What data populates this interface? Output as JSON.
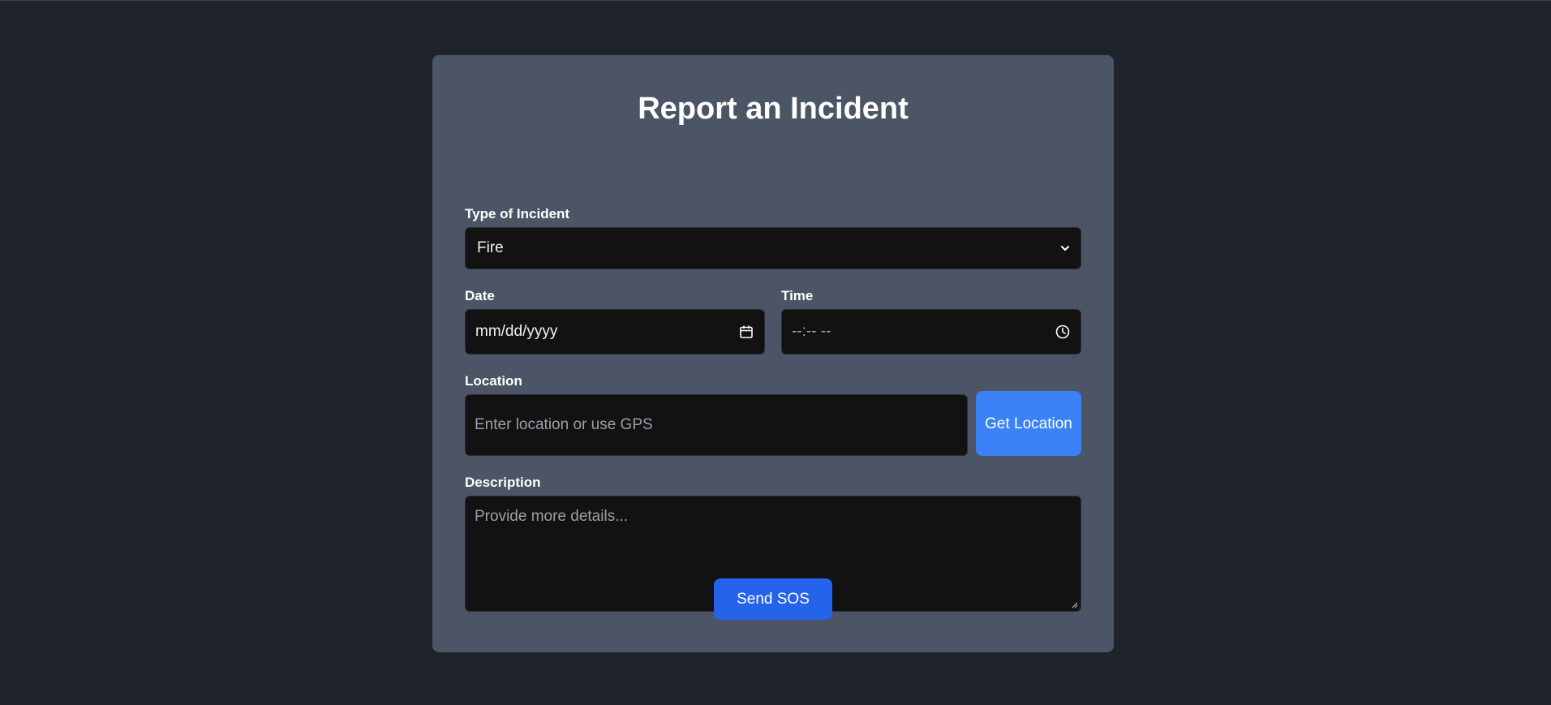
{
  "form": {
    "title": "Report an Incident",
    "incident_type": {
      "label": "Type of Incident",
      "selected_value": "Fire"
    },
    "date": {
      "label": "Date",
      "placeholder": "mm/dd/yyyy"
    },
    "time": {
      "label": "Time",
      "placeholder": "--:-- --"
    },
    "location": {
      "label": "Location",
      "placeholder": "Enter location or use GPS",
      "button_label": "Get Location"
    },
    "description": {
      "label": "Description",
      "placeholder": "Provide more details..."
    },
    "submit_label": "Send SOS"
  },
  "icons": {
    "dropdown": "chevron-down-icon",
    "date": "calendar-icon",
    "time": "clock-icon"
  },
  "colors": {
    "page_background": "#1f232b",
    "card_background": "#4c5565",
    "field_background": "#121212",
    "get_location_button": "#3b82f6",
    "send_button": "#2563eb"
  }
}
